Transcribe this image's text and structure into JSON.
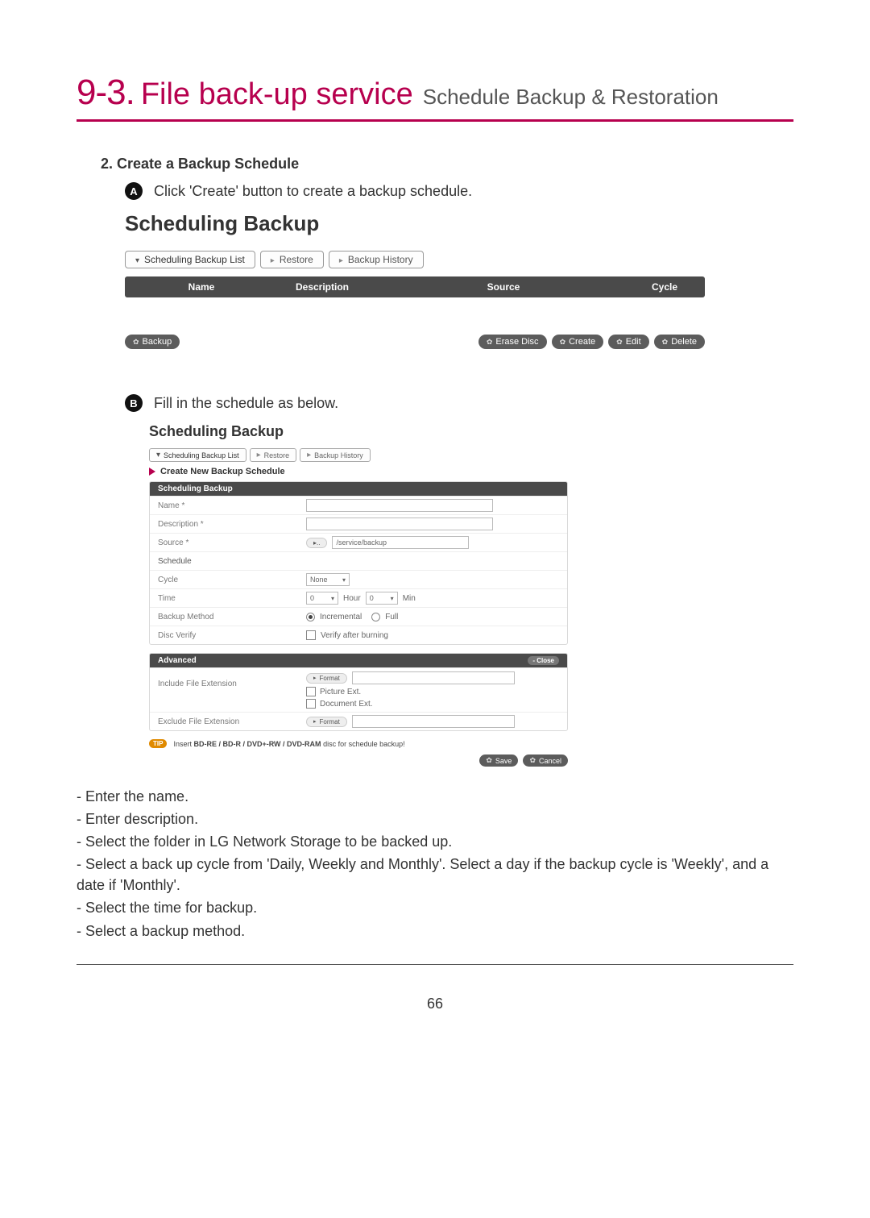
{
  "title": {
    "num_prefix": "9-3",
    "dot": ".",
    "main": "File back-up service",
    "sub": "Schedule Backup & Restoration"
  },
  "step2": {
    "heading": "2. Create a Backup Schedule",
    "letter_a": "A",
    "text_a": "Click 'Create' button to create a backup schedule.",
    "letter_b": "B",
    "text_b": "Fill in the schedule as below."
  },
  "shot1": {
    "heading": "Scheduling Backup",
    "tabs": {
      "list": "Scheduling Backup List",
      "restore": "Restore",
      "history": "Backup History"
    },
    "columns": {
      "name": "Name",
      "description": "Description",
      "source": "Source",
      "cycle": "Cycle"
    },
    "buttons": {
      "backup": "Backup",
      "erase": "Erase Disc",
      "create": "Create",
      "edit": "Edit",
      "delete": "Delete"
    }
  },
  "shot2": {
    "heading": "Scheduling Backup",
    "tabs": {
      "list": "Scheduling Backup List",
      "restore": "Restore",
      "history": "Backup History"
    },
    "subhead": "Create New Backup Schedule",
    "panel1": {
      "title": "Scheduling Backup",
      "rows": {
        "name": "Name *",
        "description": "Description *",
        "source": "Source *",
        "source_path": "/service/backup",
        "schedule": "Schedule",
        "cycle": "Cycle",
        "cycle_val": "None",
        "time": "Time",
        "time_hour_val": "0",
        "time_hour": "Hour",
        "time_min_val": "0",
        "time_min": "Min",
        "method": "Backup Method",
        "method_inc": "Incremental",
        "method_full": "Full",
        "verify": "Disc Verify",
        "verify_lbl": "Verify after burning"
      }
    },
    "panel2": {
      "title": "Advanced",
      "close": "- Close",
      "include_label": "Include File Extension",
      "format_btn": "Format",
      "picture_ext": "Picture Ext.",
      "document_ext": "Document Ext.",
      "exclude_label": "Exclude File Extension"
    },
    "tip": {
      "badge": "TIP",
      "text_prefix": "Insert ",
      "text_bold": "BD-RE / BD-R / DVD+-RW / DVD-RAM",
      "text_suffix": " disc for schedule backup!"
    },
    "buttons": {
      "save": "Save",
      "cancel": "Cancel"
    }
  },
  "body": {
    "l1": "- Enter the name.",
    "l2": "- Enter description.",
    "l3": "- Select the folder in LG Network Storage to be backed up.",
    "l4": "- Select a back up cycle from 'Daily, Weekly and Monthly'. Select a day if the backup cycle is 'Weekly', and a date if 'Monthly'.",
    "l5": "- Select the time for backup.",
    "l6": "- Select a backup method."
  },
  "pagenum": "66"
}
